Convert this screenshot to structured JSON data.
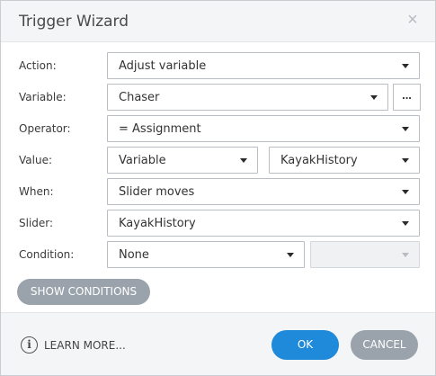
{
  "dialog": {
    "title": "Trigger Wizard",
    "close_glyph": "×"
  },
  "fields": {
    "action": {
      "label": "Action:",
      "value": "Adjust variable"
    },
    "variable": {
      "label": "Variable:",
      "value": "Chaser",
      "more_label": "..."
    },
    "operator": {
      "label": "Operator:",
      "value": "= Assignment"
    },
    "value": {
      "label": "Value:",
      "type_value": "Variable",
      "variable_value": "KayakHistory"
    },
    "when": {
      "label": "When:",
      "value": "Slider moves"
    },
    "slider": {
      "label": "Slider:",
      "value": "KayakHistory"
    },
    "condition": {
      "label": "Condition:",
      "value": "None",
      "secondary_value": ""
    }
  },
  "show_conditions_label": "SHOW CONDITIONS",
  "footer": {
    "info_glyph": "i",
    "learn_more_label": "LEARN MORE...",
    "ok_label": "OK",
    "cancel_label": "CANCEL"
  },
  "colors": {
    "primary": "#1f8ad9",
    "secondary": "#9aa3ab"
  }
}
